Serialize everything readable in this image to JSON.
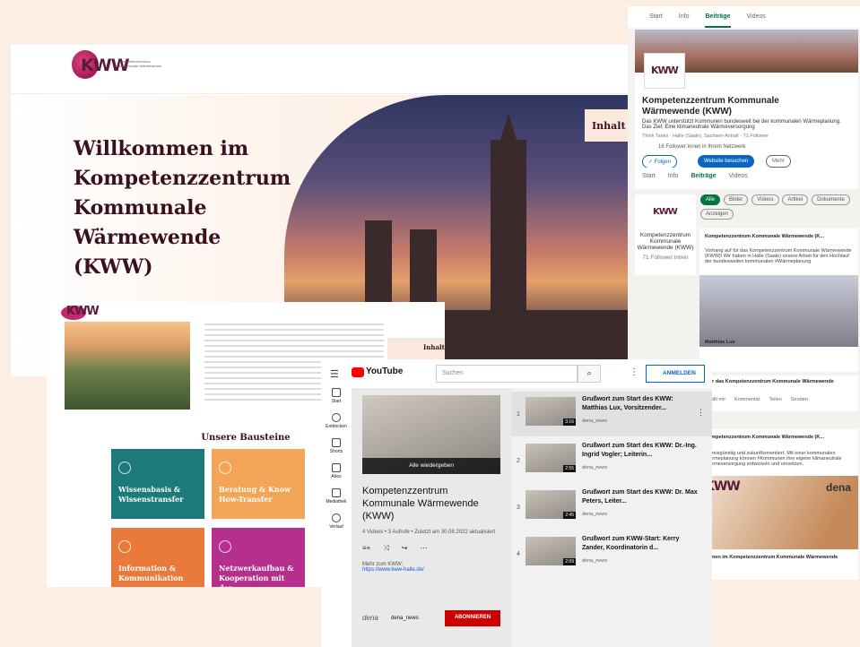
{
  "website": {
    "logo": "KWW",
    "logo_sub": "Kompetenzzentrum Kommunale Wärmewende",
    "hero_title": "Willkommen im Kompetenzzentrum Kommunale Wärmewende (KWW)",
    "inhalt": "Inhalt"
  },
  "linkedin": {
    "top_tabs": [
      "Start",
      "Info",
      "Beiträge",
      "Videos"
    ],
    "title": "Kompetenzzentrum Kommunale Wärmewende (KWW)",
    "desc": "Das KWW unterstützt Kommunen bundesweit bei der kommunalen Wärmeplanung. Das Ziel: Eine klimaneutrale Wärmeversorgung",
    "meta": "Think Tanks · Halle (Saale), Sachsen-Anhalt · 71 Follower",
    "network": "16 Follower:innen in Ihrem Netzwerk",
    "follow": "✓ Folgen",
    "website_btn": "Website besuchen",
    "more": "Mehr",
    "tabs": [
      "Start",
      "Info",
      "Beiträge",
      "Videos"
    ],
    "filters": [
      "Alle",
      "Bilder",
      "Videos",
      "Artikel",
      "Dokumente",
      "Anzeigen"
    ],
    "side_name": "Kompetenzzentrum Kommunale Wärmewende (KWW)",
    "side_followers": "71 Follower:innen",
    "post_author": "Kompetenzzentrum Kommunale Wärmewende (K...",
    "post_text": "Vorhang auf für das Kompetenzzentrum Kommunale Wärmewende (KWW)! Wir haben in Halle (Saale) unsere Arbeit für den Hochlauf der bundesweiten kommunalen #Wärmeplanung",
    "person": "Matthias Lux",
    "post_title": "it für das Kompetenzzentrum Kommunale Wärmewende",
    "actions": [
      "Gefällt mir",
      "Kommentar",
      "Teilen",
      "Senden"
    ],
    "post2_text": "t, preisgünstig und zukunftsorientiert. Mit einer kommunalen Wärmeplanung können #Kommunen ihre eigene klimaneutrale Wärmeversorgung entwickeln und umsetzen.",
    "dena": "dena",
    "post2_title": "komen im Kompetenzzentrum Kommunale Wärmewende"
  },
  "subpage": {
    "inhalt": "Inhalt",
    "heading": "Unsere Bausteine",
    "tiles": [
      {
        "label": "Wissensbasis & Wissenstransfer",
        "color": "#1d7a7a"
      },
      {
        "label": "Beratung & Know How-Transfer",
        "color": "#f2a557"
      },
      {
        "label": "Information & Kommunikation",
        "color": "#e97a3c"
      },
      {
        "label": "Netzwerkaufbau & Kooperation mit der",
        "color": "#b62f8c"
      }
    ]
  },
  "youtube": {
    "logo": "YouTube",
    "search": "Suchen",
    "signin": "ANMELDEN",
    "nav": [
      "Start",
      "Entdecken",
      "Shorts",
      "Abos",
      "Mediathek",
      "Verlauf"
    ],
    "playall": "Alle wiedergeben",
    "pl_title": "Kompetenzzentrum Kommunale Wärmewende (KWW)",
    "pl_meta": "4 Videos • 3 Aufrufe • Zuletzt am 30.08.2022 aktualisiert",
    "more": "Mehr zum KWW:",
    "link": "https://www.kww-halle.de/",
    "channel": "dena_news",
    "subscribe": "ABONNIEREN",
    "videos": [
      {
        "n": "1",
        "title": "Grußwort zum Start des KWW: Matthias Lux, Vorsitzender...",
        "dur": "3:16",
        "ch": "dena_news"
      },
      {
        "n": "2",
        "title": "Grußwort zum Start des KWW: Dr.-Ing. Ingrid Vogler; Leiterin...",
        "dur": "2:55",
        "ch": "dena_news"
      },
      {
        "n": "3",
        "title": "Grußwort zum Start des KWW: Dr. Max Peters, Leiter...",
        "dur": "2:45",
        "ch": "dena_news"
      },
      {
        "n": "4",
        "title": "Grußwort zum KWW-Start: Kerry Zander, Koordinatorin d...",
        "dur": "2:09",
        "ch": "dena_news"
      }
    ]
  }
}
